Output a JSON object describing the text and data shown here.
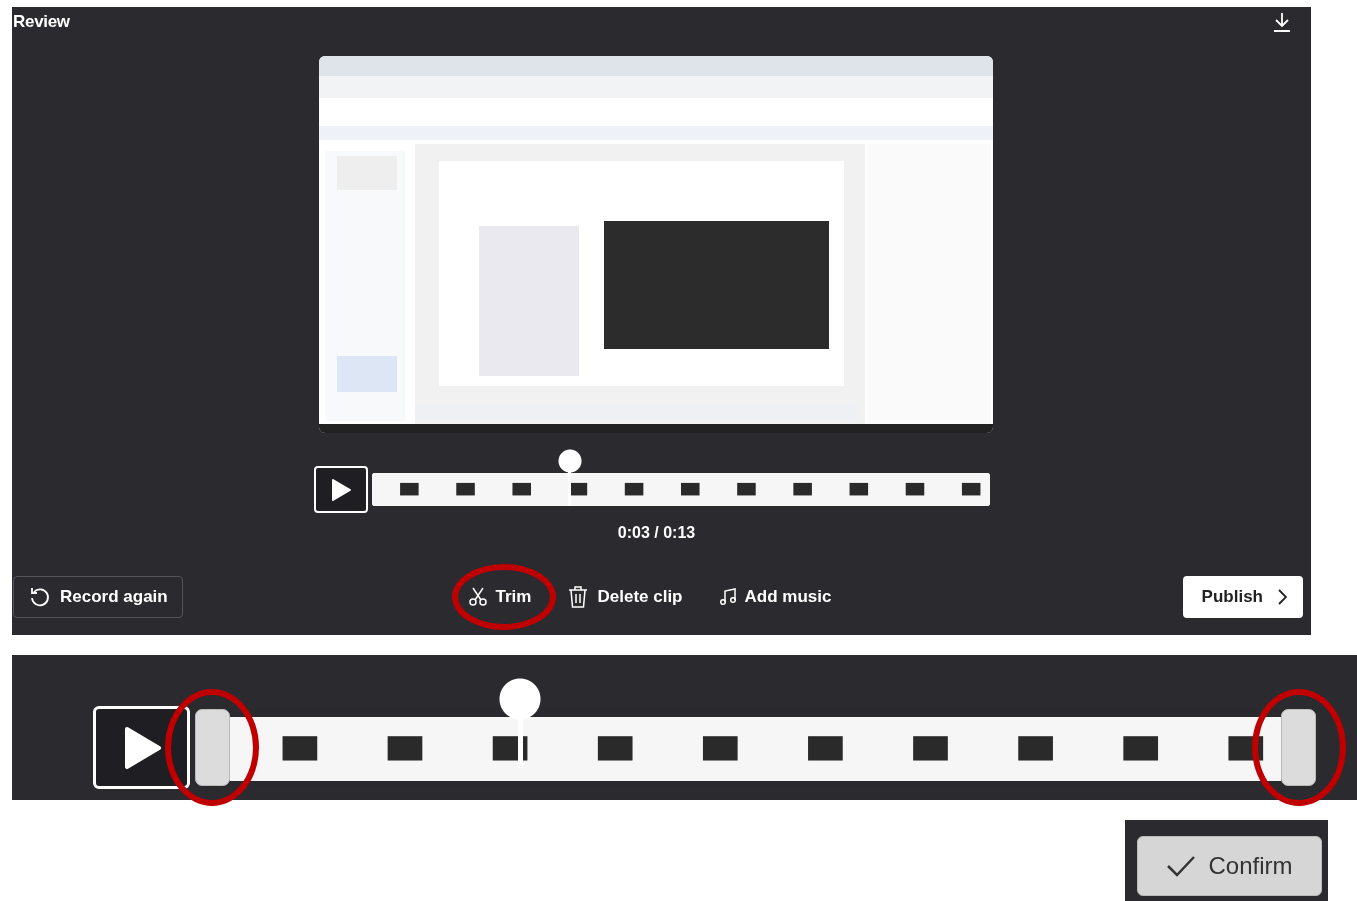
{
  "header": {
    "title": "Review"
  },
  "player": {
    "time": "0:03 / 0:13",
    "playhead": {
      "level": 0.32
    }
  },
  "actions": [
    {
      "kind": "record",
      "label": "Record again",
      "highlighted": false
    },
    {
      "kind": "trim",
      "label": "Trim",
      "highlighted": true
    },
    {
      "kind": "delete",
      "label": "Delete clip",
      "highlighted": false
    },
    {
      "kind": "music",
      "label": "Add music",
      "highlighted": false
    },
    {
      "kind": "publish",
      "label": "Publish",
      "highlighted": false
    }
  ],
  "trim_editor": {
    "playhead": {
      "level": 0.29
    },
    "handles": [
      {
        "highlighted": true
      },
      {
        "highlighted": true
      }
    ]
  },
  "confirm": {
    "label": "Confirm"
  }
}
